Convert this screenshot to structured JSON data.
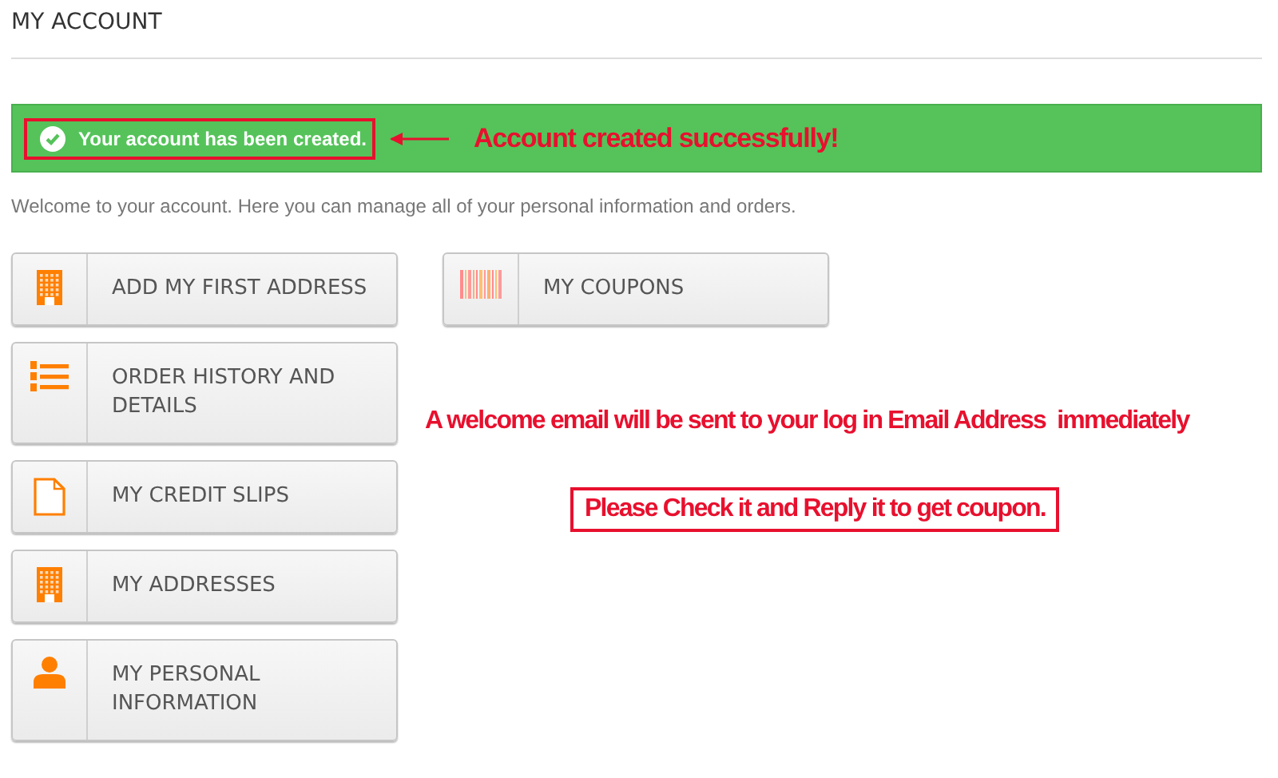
{
  "page_title": "MY ACCOUNT",
  "alert": {
    "message": "Your account has been created.",
    "highlighted": true
  },
  "callout": "Account created successfully!",
  "intro": "Welcome to your account. Here you can manage all of your personal information and orders.",
  "columns": [
    {
      "tiles": [
        {
          "kind": "building",
          "label": "ADD MY FIRST ADDRESS"
        },
        {
          "kind": "list",
          "label": "ORDER HISTORY AND DETAILS"
        },
        {
          "kind": "document",
          "label": "MY CREDIT SLIPS"
        },
        {
          "kind": "building",
          "label": "MY ADDRESSES"
        },
        {
          "kind": "person",
          "label": "MY PERSONAL INFORMATION"
        }
      ]
    },
    {
      "tiles": [
        {
          "kind": "barcode",
          "label": "MY COUPONS"
        }
      ]
    }
  ],
  "notes": [
    {
      "text": "A welcome email will be sent to your log in Email Address  immediately",
      "boxed": false
    },
    {
      "text": "Please Check it and Reply it to get coupon.",
      "boxed": true
    }
  ]
}
